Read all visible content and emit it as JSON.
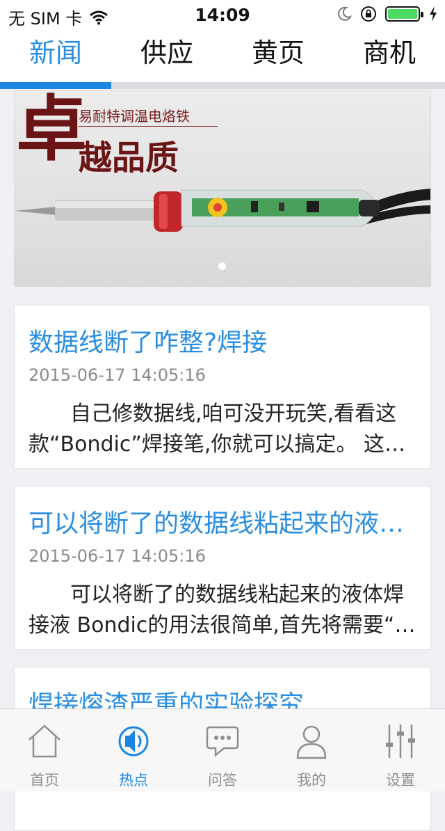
{
  "status_bar": {
    "carrier": "无 SIM 卡",
    "time": "14:09"
  },
  "top_tabs": {
    "active_index": 0,
    "items": [
      {
        "label": "新闻"
      },
      {
        "label": "供应"
      },
      {
        "label": "黄页"
      },
      {
        "label": "商机"
      }
    ]
  },
  "banner": {
    "big_char": "卓",
    "small_caption": "易耐特调温电烙铁",
    "headline": "越品质",
    "page_count": 1,
    "current_page": 0
  },
  "news": [
    {
      "title": "数据线断了咋整?焊接",
      "date": "2015-06-17 14:05:16",
      "summary": "自己修数据线,咱可没开玩笑,看看这款“Bondic”焊接笔,你就可以搞定。 这款笔通过紫外光固化液体塑料来修复断线"
    },
    {
      "title": "可以将断了的数据线粘起来的液体焊接液",
      "date": "2015-06-17 14:05:16",
      "summary": "可以将断了的数据线粘起来的液体焊接液 Bondic的用法很简单,首先将需要“焊接”的地方清理干净"
    },
    {
      "title": "焊接熔渣严重的实验探究",
      "date": "",
      "summary": ""
    }
  ],
  "bottom_tabs": {
    "active_index": 1,
    "items": [
      {
        "label": "首页",
        "icon": "home-icon"
      },
      {
        "label": "热点",
        "icon": "hotspot-icon"
      },
      {
        "label": "问答",
        "icon": "chat-icon"
      },
      {
        "label": "我的",
        "icon": "user-icon"
      },
      {
        "label": "设置",
        "icon": "settings-icon"
      }
    ]
  },
  "colors": {
    "accent": "#1a86e0",
    "title_blue": "#2a8ee0",
    "inactive_gray": "#8e8e8e"
  }
}
